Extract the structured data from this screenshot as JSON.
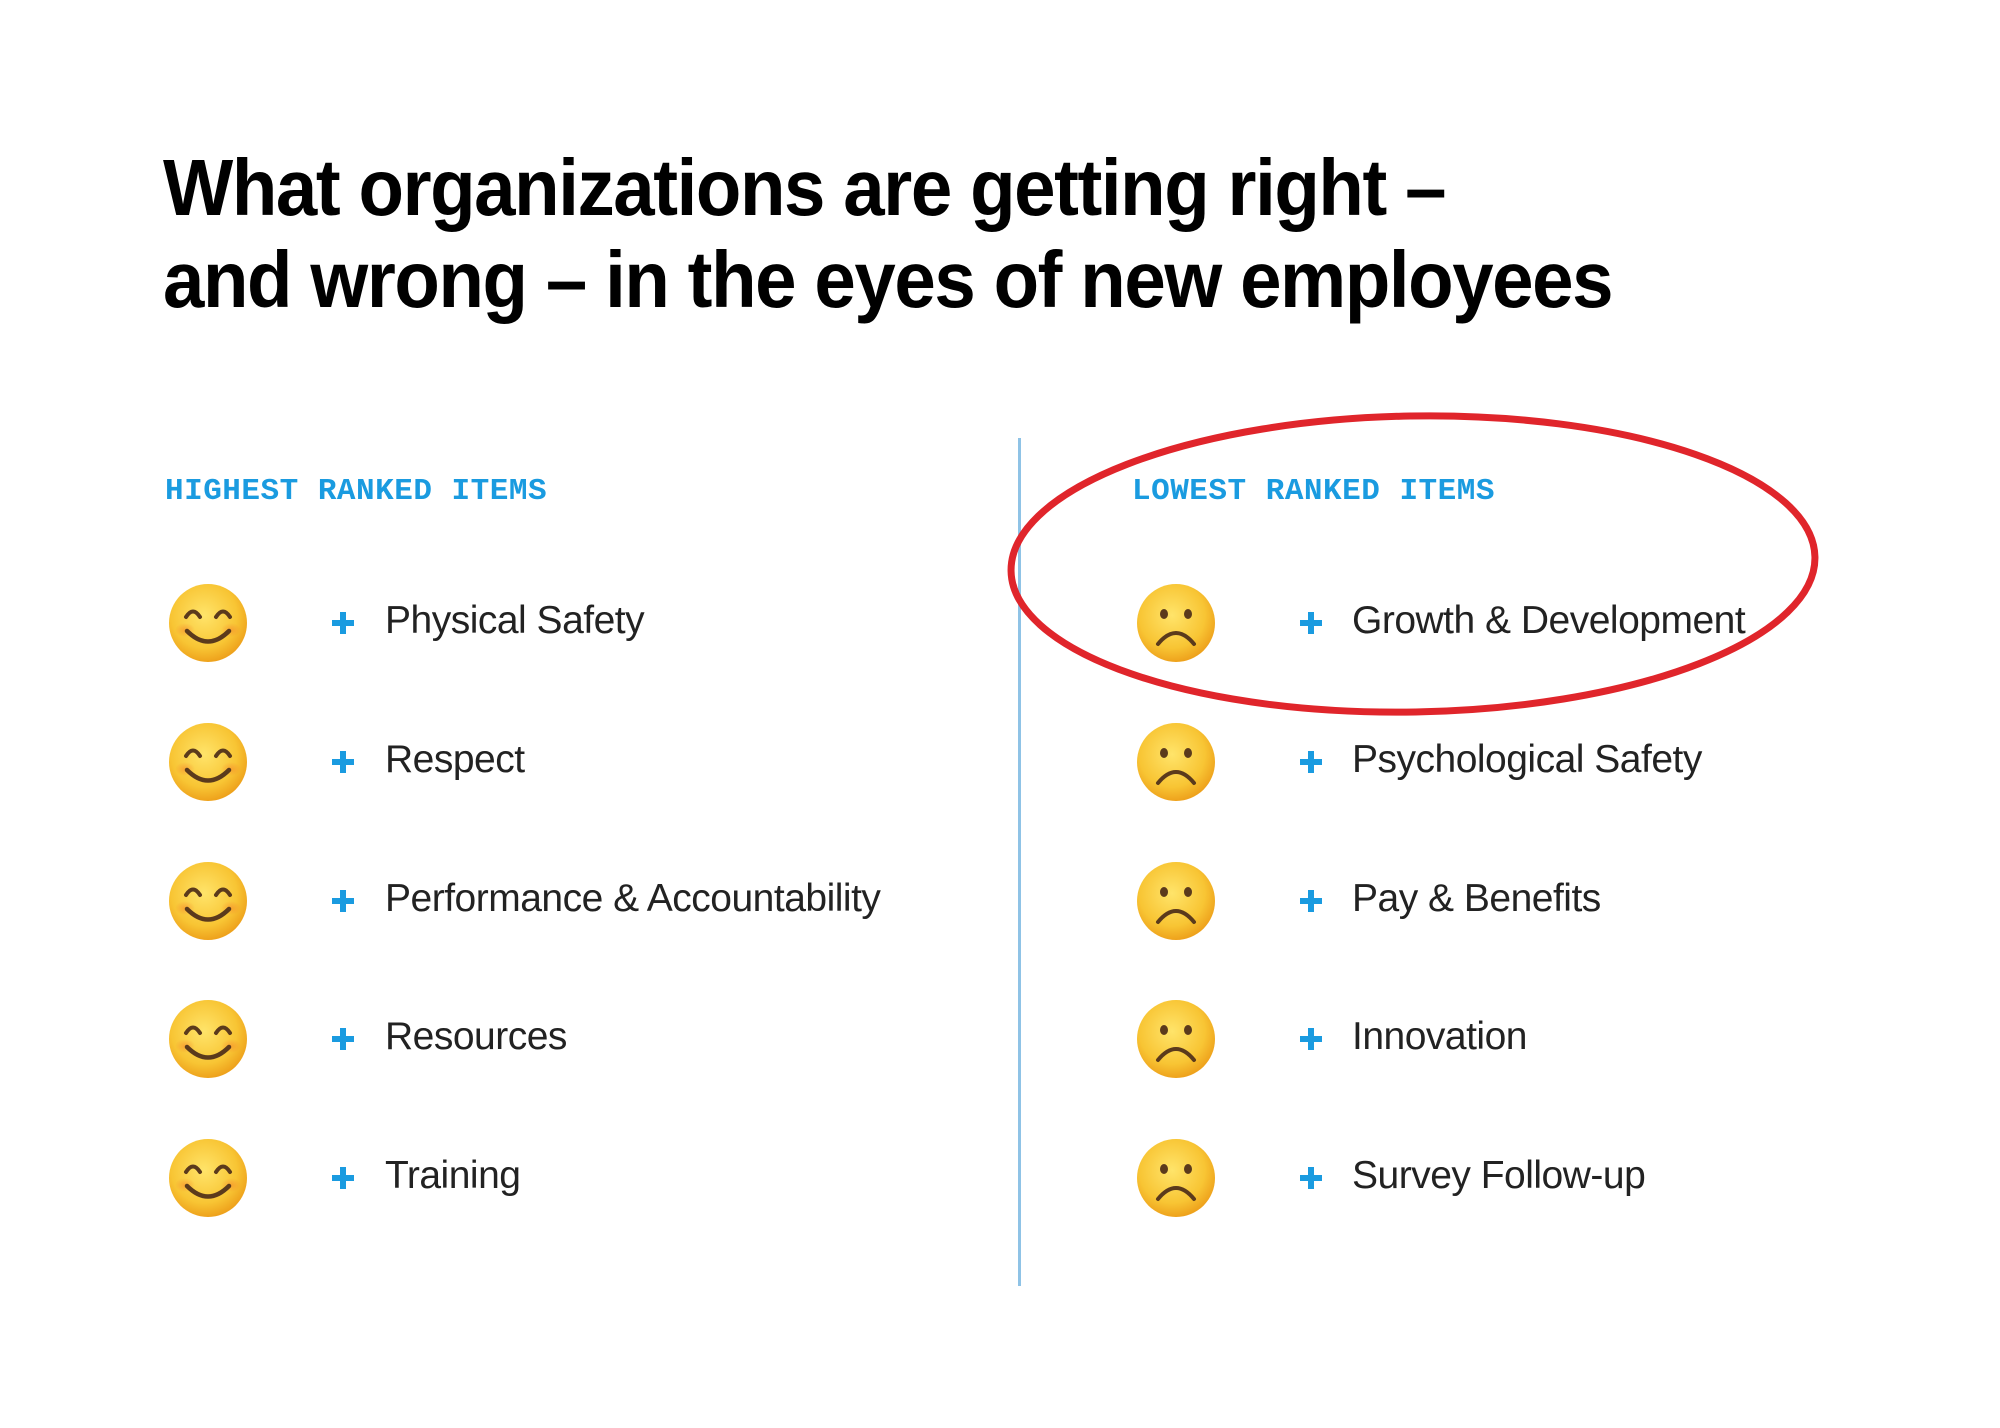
{
  "title": {
    "line1": "What organizations are getting right –",
    "line2": "and wrong – in the eyes of new employees"
  },
  "highest": {
    "header": "HIGHEST RANKED ITEMS",
    "icon": "smiling-face-icon",
    "items": [
      {
        "label": "Physical Safety"
      },
      {
        "label": "Respect"
      },
      {
        "label": "Performance & Accountability"
      },
      {
        "label": "Resources"
      },
      {
        "label": "Training"
      }
    ]
  },
  "lowest": {
    "header": "LOWEST RANKED ITEMS",
    "icon": "frowning-face-icon",
    "items": [
      {
        "label": "Growth & Development"
      },
      {
        "label": "Psychological Safety"
      },
      {
        "label": "Pay & Benefits"
      },
      {
        "label": "Innovation"
      },
      {
        "label": "Survey Follow-up"
      }
    ]
  },
  "annotation": {
    "type": "circle-highlight",
    "target": "Growth & Development",
    "color": "#e0252b"
  },
  "colors": {
    "accent": "#1a9be0",
    "divider": "#8fc3e6",
    "text": "#222222",
    "emoji": "#f7c23a"
  }
}
